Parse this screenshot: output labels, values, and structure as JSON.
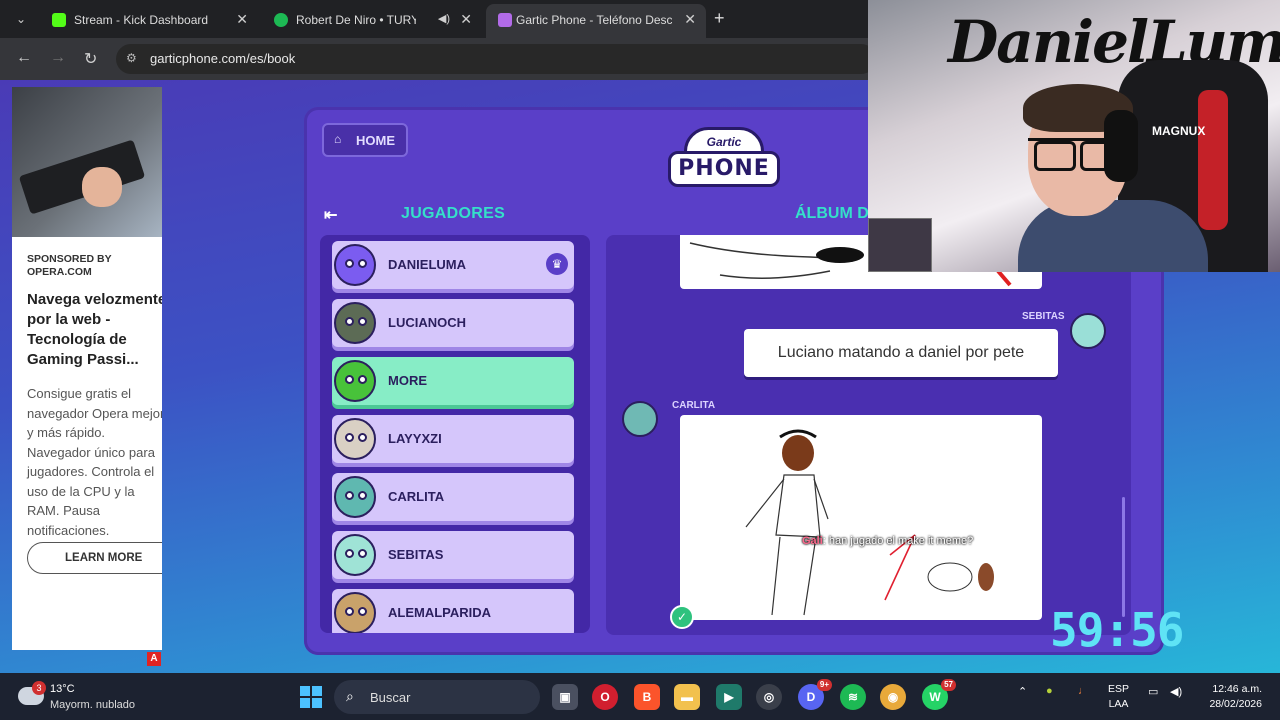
{
  "browser": {
    "tabs": [
      {
        "title": "Stream - Kick Dashboard",
        "favicon": "kick-icon",
        "color": "#53fc18"
      },
      {
        "title": "Robert De Niro • TURY",
        "favicon": "spotify-icon",
        "color": "#1db954"
      },
      {
        "title": "Gartic Phone - Teléfono Descon",
        "favicon": "phone-icon",
        "color": "#b26be8"
      }
    ],
    "url": "garticphone.com/es/book"
  },
  "ad": {
    "sponsor": "SPONSORED BY OPERA.COM",
    "headline": "Navega velozmente por la web - Tecnología de Gaming Passi...",
    "body": "Consigue gratis el navegador Opera mejor y más rápido. Navegador único para jugadores. Controla el uso de la CPU y la RAM. Pausa notificaciones.",
    "cta": "LEARN MORE"
  },
  "game": {
    "home_label": "HOME",
    "logo_top": "Gartic",
    "logo_main": "PHONE",
    "players_title": "JUGADORES",
    "album_title": "ÁLBUM D",
    "players": [
      {
        "name": "DANIELUMA",
        "color": "#7b5cf0",
        "host": true
      },
      {
        "name": "LUCIANOCH",
        "color": "#5c6b55"
      },
      {
        "name": "MORE",
        "color": "#48c23a",
        "highlight": true
      },
      {
        "name": "LAYYXZI",
        "color": "#d9d0c4"
      },
      {
        "name": "CARLITA",
        "color": "#5fb8b0"
      },
      {
        "name": "SEBITAS",
        "color": "#9fe3d6"
      },
      {
        "name": "ALEMALPARIDA",
        "color": "#c9a26a"
      }
    ],
    "album": {
      "sebitas_name": "SEBITAS",
      "phrase": "Luciano matando a daniel por pete",
      "carlita_name": "CARLITA",
      "chat_user": "Gali",
      "chat_text": ": han jugado el make it meme?"
    }
  },
  "cam": {
    "graffiti": "DanielLuma",
    "chair_text": "MAGNUX"
  },
  "timer": "59:56",
  "taskbar": {
    "weather_temp": "13°C",
    "weather_desc": "Mayorm. nublado",
    "weather_badge": "3",
    "search": "Buscar",
    "discord_badge": "9+",
    "whatsapp_badge": "57",
    "lang_1": "ESP",
    "lang_2": "LAA",
    "time": "12:46 a.m.",
    "date": "28/02/2026"
  }
}
